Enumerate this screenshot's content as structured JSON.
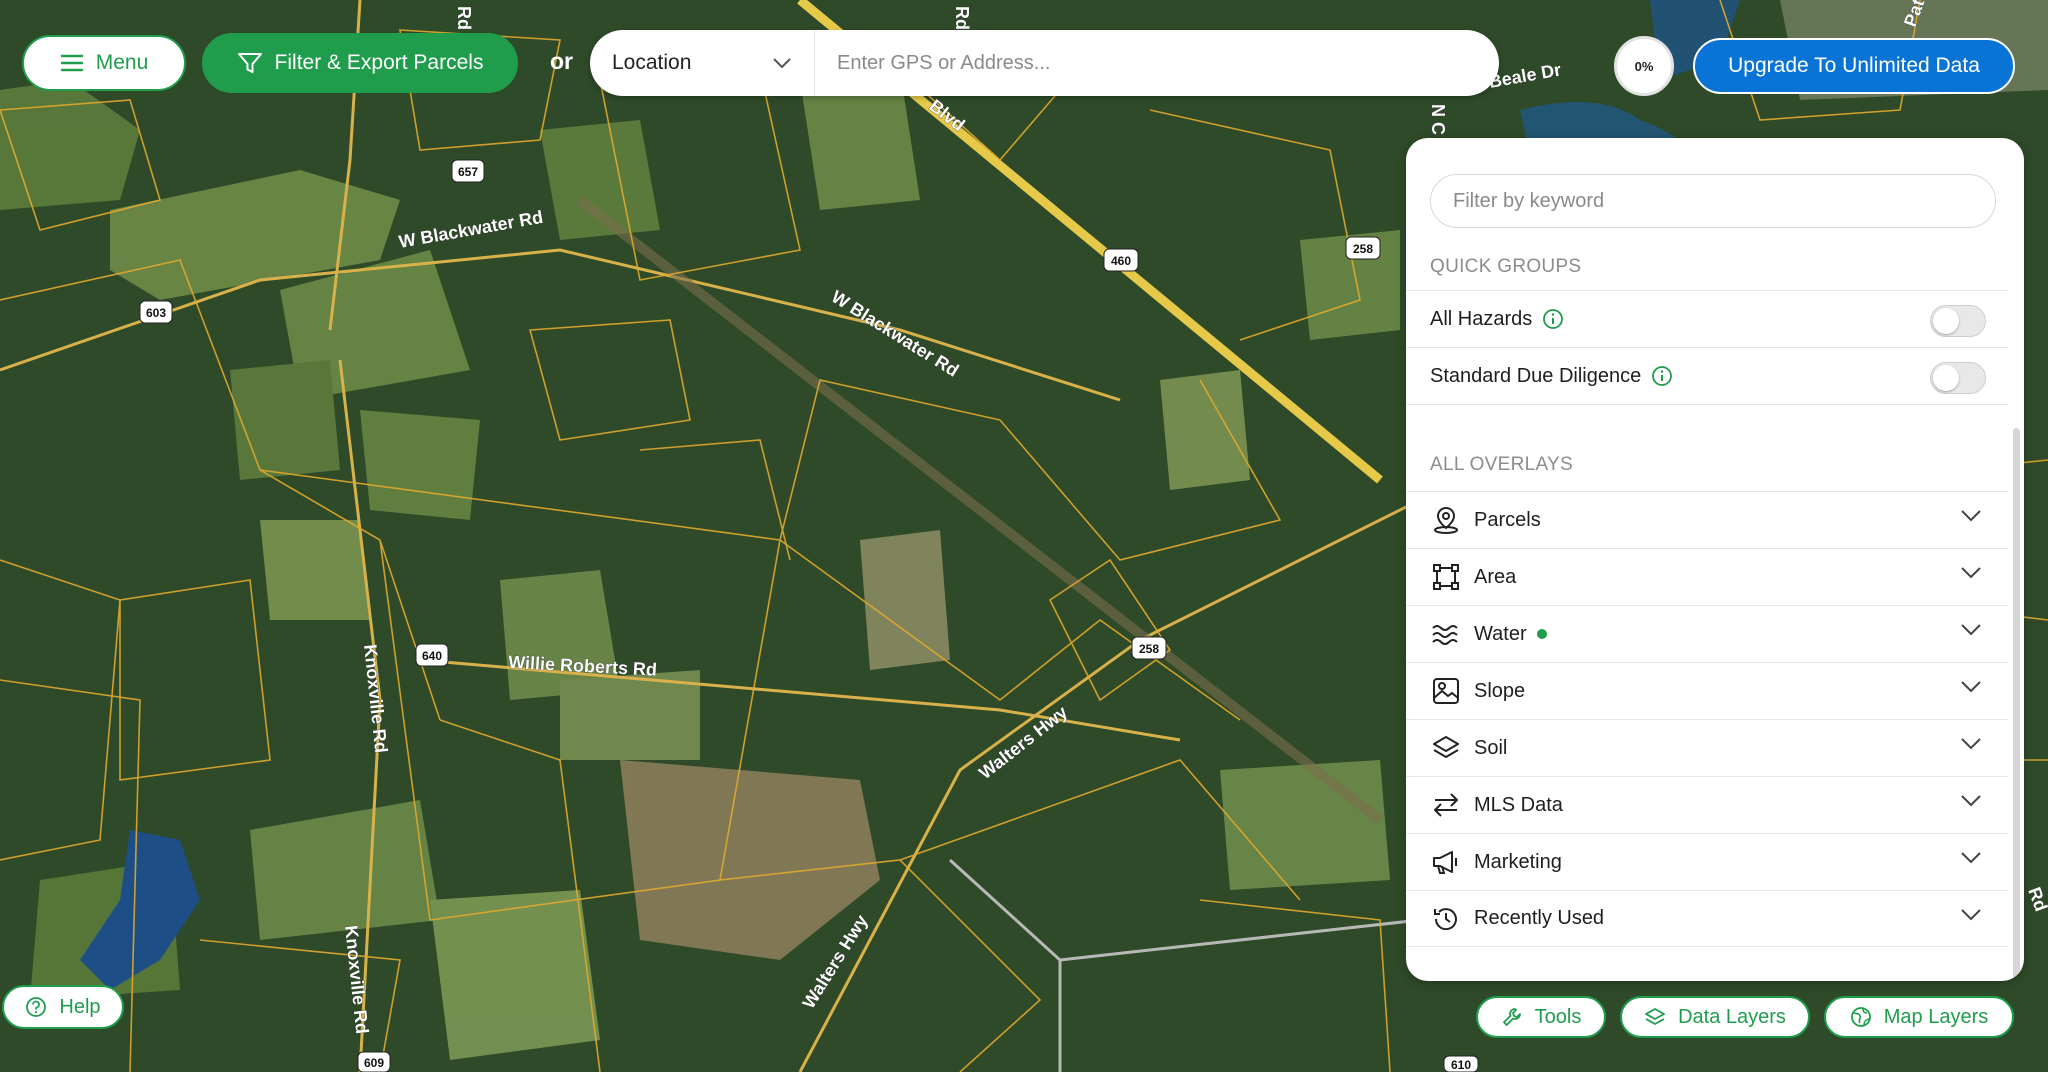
{
  "toolbar": {
    "menu_label": "Menu",
    "filter_label": "Filter & Export Parcels",
    "or_label": "or",
    "location_label": "Location",
    "address_placeholder": "Enter GPS or Address...",
    "progress_label": "0%",
    "upgrade_label": "Upgrade To Unlimited Data"
  },
  "panel": {
    "keyword_placeholder": "Filter by keyword",
    "quick_groups_heading": "QUICK GROUPS",
    "quick_groups": [
      {
        "label": "All Hazards",
        "enabled": false
      },
      {
        "label": "Standard Due Diligence",
        "enabled": false
      }
    ],
    "overlays_heading": "ALL OVERLAYS",
    "overlays": [
      {
        "label": "Parcels",
        "icon": "map-pin-icon"
      },
      {
        "label": "Area",
        "icon": "area-square-icon"
      },
      {
        "label": "Water",
        "icon": "water-waves-icon",
        "active": true
      },
      {
        "label": "Slope",
        "icon": "slope-image-icon"
      },
      {
        "label": "Soil",
        "icon": "soil-layers-icon"
      },
      {
        "label": "MLS Data",
        "icon": "transfer-arrows-icon"
      },
      {
        "label": "Marketing",
        "icon": "megaphone-icon"
      },
      {
        "label": "Recently Used",
        "icon": "history-clock-icon"
      }
    ]
  },
  "bottom": {
    "help_label": "Help",
    "tools_label": "Tools",
    "data_layers_label": "Data Layers",
    "map_layers_label": "Map Layers"
  },
  "map": {
    "road_labels": [
      "W Blackwater Rd",
      "W Blackwater Rd",
      "Willie Roberts Rd",
      "Knoxville Rd",
      "Knoxville Rd",
      "Walters Hwy",
      "Walters Hwy",
      "Beale Dr",
      "Blvd",
      "Rd",
      "Rd",
      "Rd",
      "Path",
      "N C"
    ],
    "shields": [
      "657",
      "603",
      "460",
      "258",
      "640",
      "258",
      "609",
      "610"
    ]
  },
  "colors": {
    "brand_green": "#1f9d4d",
    "upgrade_blue": "#0a74d6",
    "parcel_line": "#e0a92e"
  }
}
